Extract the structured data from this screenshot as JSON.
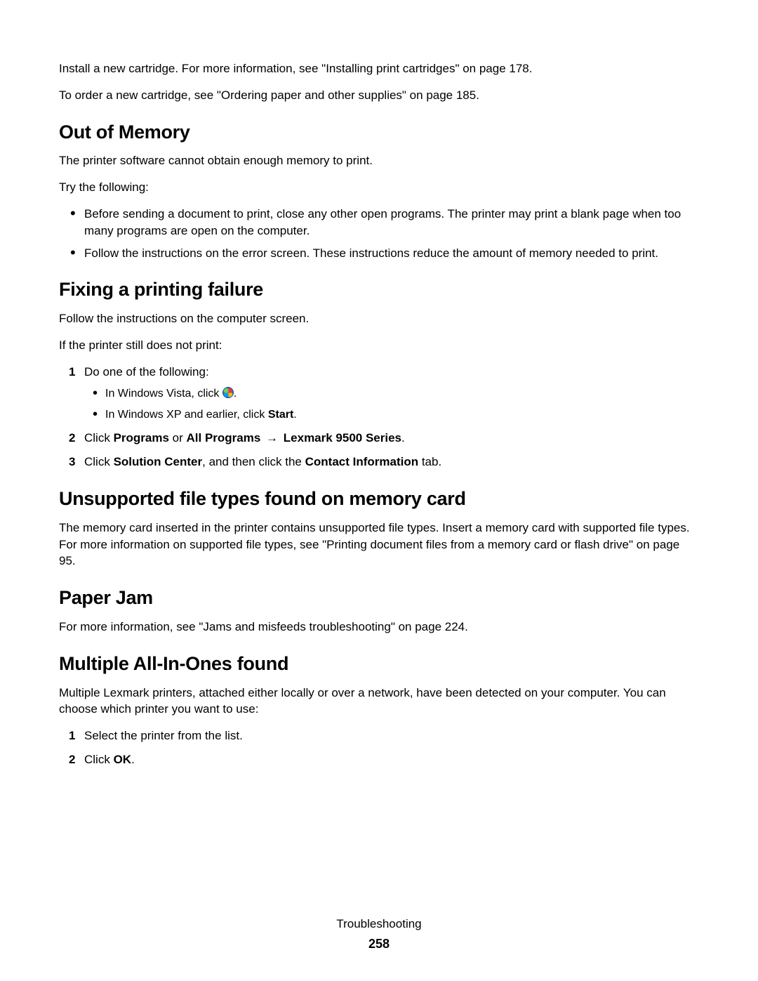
{
  "intro": {
    "p1": "Install a new cartridge. For more information, see \"Installing print cartridges\" on page 178.",
    "p2": "To order a new cartridge, see \"Ordering paper and other supplies\" on page 185."
  },
  "sections": {
    "out_of_memory": {
      "title": "Out of Memory",
      "p1": "The printer software cannot obtain enough memory to print.",
      "p2": "Try the following:",
      "bullets": [
        "Before sending a document to print, close any other open programs. The printer may print a blank page when too many programs are open on the computer.",
        "Follow the instructions on the error screen. These instructions reduce the amount of memory needed to print."
      ]
    },
    "fixing_failure": {
      "title": "Fixing a printing failure",
      "p1": "Follow the instructions on the computer screen.",
      "p2": "If the printer still does not print:",
      "step1_text": "Do one of the following:",
      "step1_sub1_prefix": "In Windows Vista, click ",
      "step1_sub1_suffix": ".",
      "step1_sub2_prefix": "In Windows XP and earlier, click ",
      "step1_sub2_bold": "Start",
      "step1_sub2_suffix": ".",
      "step2_prefix": "Click ",
      "step2_b1": "Programs",
      "step2_mid1": " or ",
      "step2_b2": "All Programs ",
      "step2_arrow": "→",
      "step2_b3": " Lexmark 9500 Series",
      "step2_suffix": ".",
      "step3_prefix": "Click ",
      "step3_b1": "Solution Center",
      "step3_mid": ", and then click the ",
      "step3_b2": "Contact Information",
      "step3_suffix": " tab."
    },
    "unsupported": {
      "title": "Unsupported file types found on memory card",
      "p1": "The memory card inserted in the printer contains unsupported file types. Insert a memory card with supported file types. For more information on supported file types, see \"Printing document files from a memory card or flash drive\" on page 95."
    },
    "paper_jam": {
      "title": "Paper Jam",
      "p1": "For more information, see \"Jams and misfeeds troubleshooting\" on page 224."
    },
    "multiple": {
      "title": "Multiple All-In-Ones found",
      "p1": "Multiple Lexmark printers, attached either locally or over a network, have been detected on your computer. You can choose which printer you want to use:",
      "step1": "Select the printer from the list.",
      "step2_prefix": "Click ",
      "step2_bold": "OK",
      "step2_suffix": "."
    }
  },
  "footer": {
    "section": "Troubleshooting",
    "page": "258"
  },
  "numbers": {
    "n1": "1",
    "n2": "2",
    "n3": "3"
  }
}
